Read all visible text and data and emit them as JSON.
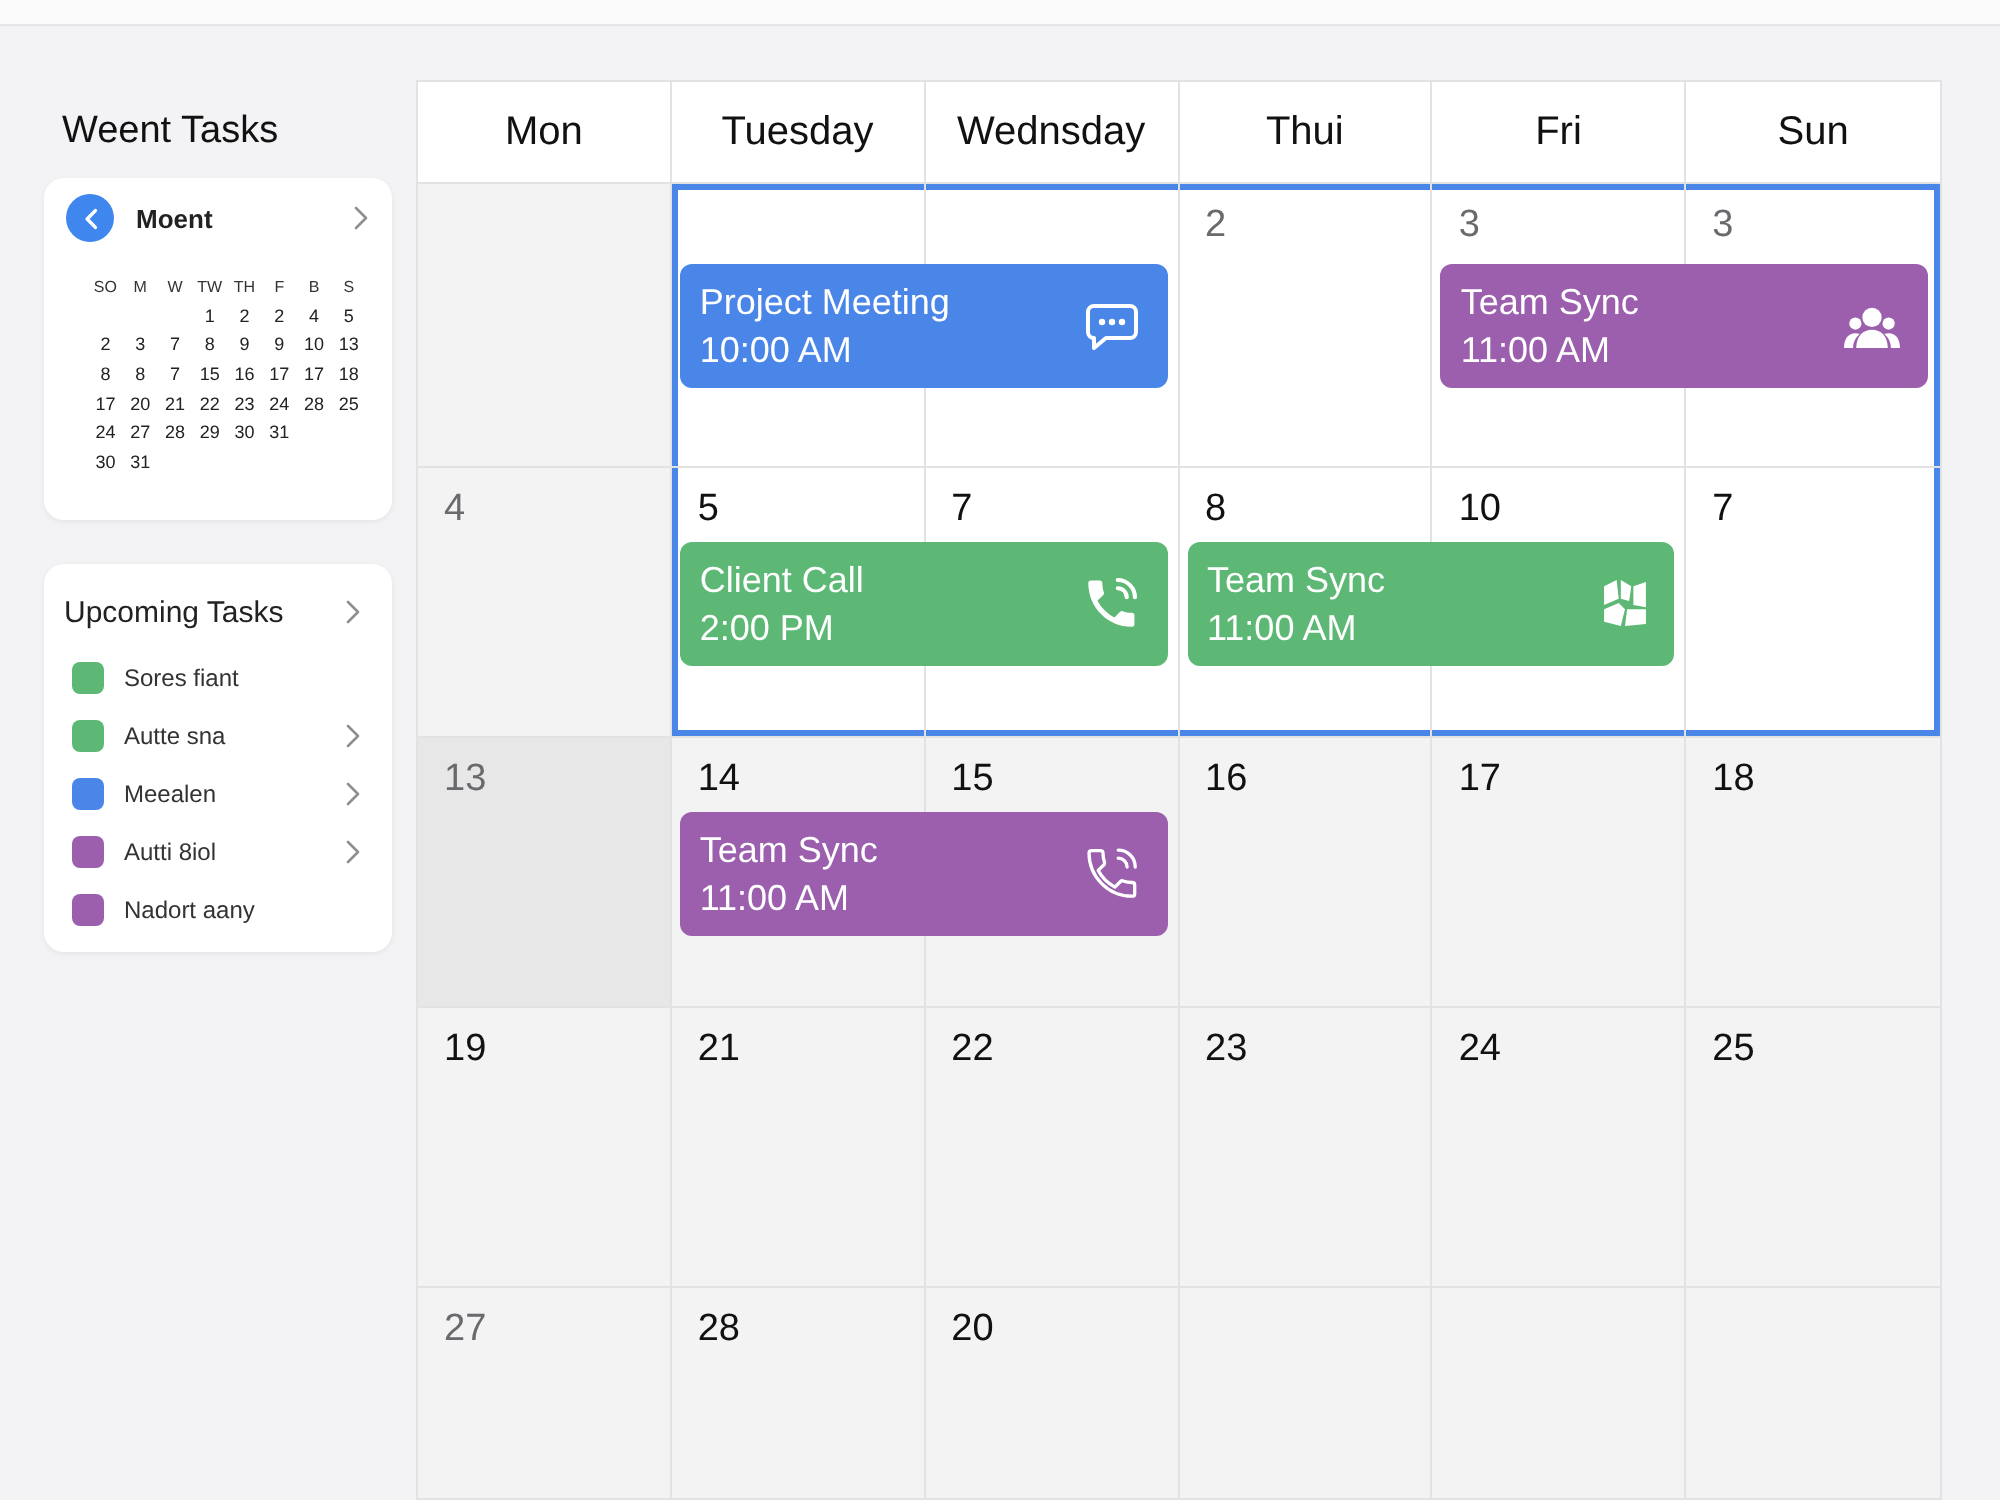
{
  "sidebar": {
    "title": "Weent Tasks",
    "mini_calendar": {
      "month": "Moent",
      "weekdays": [
        "SO",
        "M",
        "W",
        "TW",
        "TH",
        "F",
        "B",
        "S"
      ],
      "weeks": [
        {
          "days": [
            "1",
            "2",
            "2",
            "4",
            "5"
          ],
          "starts_mid_week": true
        },
        {
          "days": [
            "2",
            "3",
            "7",
            "8",
            "9",
            "9",
            "10",
            "13"
          ]
        },
        {
          "days": [
            "8",
            "8",
            "7",
            "15",
            "16",
            "17",
            "17",
            "18"
          ]
        },
        {
          "days": [
            "17",
            "20",
            "21",
            "22",
            "23",
            "24",
            "28",
            "25"
          ]
        },
        {
          "days": [
            "24",
            "27",
            "28",
            "29",
            "30",
            "31"
          ],
          "starts_mid_week": false
        },
        {
          "days": [
            "30",
            "31"
          ],
          "starts_mid_week": false
        }
      ]
    },
    "upcoming": {
      "title": "Upcoming Tasks",
      "items": [
        {
          "label": "Sores fiant",
          "color": "#5cb874",
          "expandable": false
        },
        {
          "label": "Autte sna",
          "color": "#5cb874",
          "expandable": true
        },
        {
          "label": "Meealen",
          "color": "#4a86e8",
          "expandable": true
        },
        {
          "label": "Autti 8iol",
          "color": "#9b5fad",
          "expandable": true
        },
        {
          "label": "Nadort aany",
          "color": "#9b5fad",
          "expandable": false
        }
      ]
    }
  },
  "calendar": {
    "weekdays": [
      "Mon",
      "Tuesday",
      "Wednsday",
      "Thui",
      "Fri",
      "Sun"
    ],
    "weeks": [
      {
        "cells": [
          {
            "shaded": false,
            "selected": false
          },
          {
            "shaded": false,
            "selected": true,
            "events": [
              {
                "title": "Project Meeting",
                "time": "10:00 AM",
                "color": "#4a86e8",
                "kind": "chat",
                "spans_next_day": true
              }
            ]
          },
          {
            "shaded": false,
            "selected": true
          },
          {
            "day": "2",
            "muted": true,
            "shaded": false,
            "selected": true
          },
          {
            "day": "3",
            "muted": true,
            "shaded": false,
            "selected": true,
            "events": [
              {
                "title": "Team Sync",
                "time": "11:00 AM",
                "color": "#9b5fad",
                "kind": "people",
                "spans_next_day": true
              }
            ]
          },
          {
            "day": "3",
            "muted": true,
            "shaded": false,
            "selected": true
          }
        ]
      },
      {
        "cells": [
          {
            "day": "4",
            "muted": true,
            "shaded": false,
            "selected": false
          },
          {
            "day": "5",
            "muted": false,
            "shaded": false,
            "selected": true,
            "events": [
              {
                "title": "Client Call",
                "time": "2:00 PM",
                "color": "#5cb874",
                "kind": "phone",
                "spans_next_day": true
              }
            ]
          },
          {
            "day": "7",
            "muted": false,
            "shaded": false,
            "selected": true
          },
          {
            "day": "8",
            "muted": false,
            "shaded": false,
            "selected": true,
            "events": [
              {
                "title": "Team Sync",
                "time": "11:00 AM",
                "color": "#5cb874",
                "kind": "map",
                "spans_next_day": true
              }
            ]
          },
          {
            "day": "10",
            "muted": false,
            "shaded": false,
            "selected": true
          },
          {
            "day": "7",
            "muted": false,
            "shaded": false,
            "selected": true
          }
        ]
      },
      {
        "cells": [
          {
            "day": "13",
            "muted": true,
            "shaded": true,
            "selected": false
          },
          {
            "day": "14",
            "muted": false,
            "shaded": false,
            "selected": false,
            "events": [
              {
                "title": "Team Sync",
                "time": "11:00 AM",
                "color": "#9b5fad",
                "kind": "phone-outline",
                "spans_next_day": true
              }
            ]
          },
          {
            "day": "15",
            "muted": false,
            "shaded": false,
            "selected": false
          },
          {
            "day": "16",
            "muted": false,
            "shaded": false,
            "selected": false
          },
          {
            "day": "17",
            "muted": false,
            "shaded": false,
            "selected": false
          },
          {
            "day": "18",
            "muted": false,
            "shaded": false,
            "selected": false
          }
        ]
      },
      {
        "cells": [
          {
            "day": "19",
            "muted": false,
            "shaded": false,
            "selected": false
          },
          {
            "day": "21",
            "muted": false,
            "shaded": false,
            "selected": false
          },
          {
            "day": "22",
            "muted": false,
            "shaded": false,
            "selected": false
          },
          {
            "day": "23",
            "muted": false,
            "shaded": false,
            "selected": false
          },
          {
            "day": "24",
            "muted": false,
            "shaded": false,
            "selected": false
          },
          {
            "day": "25",
            "muted": false,
            "shaded": false,
            "selected": false
          }
        ]
      },
      {
        "cells": [
          {
            "day": "27",
            "muted": true,
            "shaded": false,
            "selected": false
          },
          {
            "day": "28",
            "muted": false,
            "shaded": false,
            "selected": false
          },
          {
            "day": "20",
            "muted": false,
            "shaded": false,
            "selected": false
          },
          {
            "shaded": false,
            "selected": false
          },
          {
            "shaded": false,
            "selected": false
          },
          {
            "shaded": false,
            "selected": false
          }
        ]
      }
    ]
  }
}
